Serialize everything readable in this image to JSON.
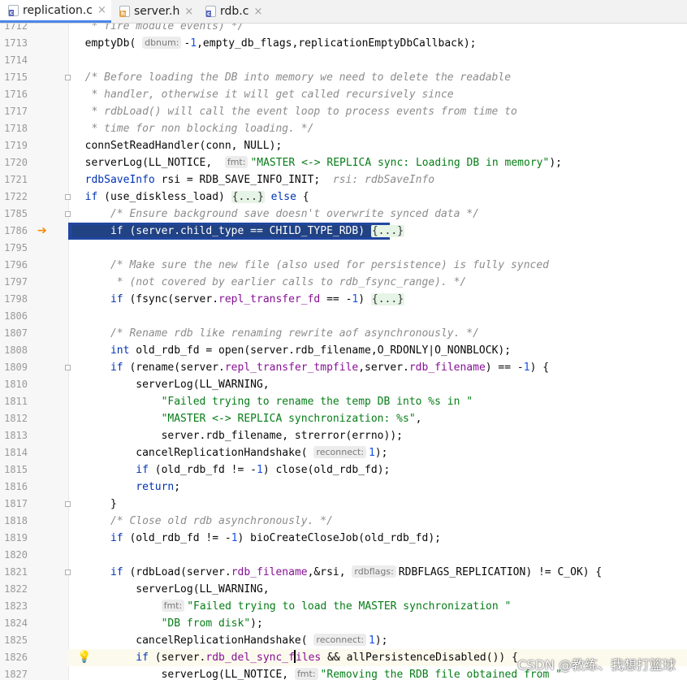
{
  "tabs": [
    {
      "label": "replication.c",
      "type": "c",
      "active": true
    },
    {
      "label": "server.h",
      "type": "h",
      "active": false
    },
    {
      "label": "rdb.c",
      "type": "c",
      "active": false
    }
  ],
  "tab_close_glyph": "×",
  "lines": [
    {
      "num": "1712",
      "segs": [
        [
          "cm",
          "   * fire module events) */"
        ]
      ]
    },
    {
      "num": "1713",
      "segs": [
        [
          "",
          "  emptyDb( "
        ],
        [
          "hint",
          "dbnum:"
        ],
        [
          "",
          "-"
        ],
        [
          "num",
          "1"
        ],
        [
          "",
          ",empty_db_flags,replicationEmptyDbCallback);"
        ]
      ]
    },
    {
      "num": "1714",
      "segs": []
    },
    {
      "num": "1715",
      "segs": [
        [
          "cm",
          "  /* Before loading the DB into memory we need to delete the readable"
        ]
      ]
    },
    {
      "num": "1716",
      "segs": [
        [
          "cm",
          "   * handler, otherwise it will get called recursively since"
        ]
      ]
    },
    {
      "num": "1717",
      "segs": [
        [
          "cm",
          "   * rdbLoad() will call the event loop to process events from time to"
        ]
      ]
    },
    {
      "num": "1718",
      "segs": [
        [
          "cm",
          "   * time for non blocking loading. */"
        ]
      ]
    },
    {
      "num": "1719",
      "segs": [
        [
          "",
          "  connSetReadHandler(conn, NULL);"
        ]
      ]
    },
    {
      "num": "1720",
      "segs": [
        [
          "",
          "  serverLog(LL_NOTICE,  "
        ],
        [
          "hint",
          "fmt:"
        ],
        [
          "str",
          "\"MASTER <-> REPLICA sync: Loading DB in memory\""
        ],
        [
          "",
          ");"
        ]
      ]
    },
    {
      "num": "1721",
      "segs": [
        [
          "kw",
          "  rdbSaveInfo"
        ],
        [
          "",
          " rsi = RDB_SAVE_INFO_INIT;  "
        ],
        [
          "cm",
          "rsi: rdbSaveInfo"
        ]
      ]
    },
    {
      "num": "1722",
      "segs": [
        [
          "kw",
          "  if"
        ],
        [
          "",
          " (use_diskless_load) "
        ],
        [
          "fold",
          "{...}"
        ],
        [
          "kw",
          " else"
        ],
        [
          "",
          " {"
        ]
      ]
    },
    {
      "num": "1785",
      "segs": [
        [
          "cm",
          "      /* Ensure background save doesn't overwrite synced data */"
        ]
      ]
    },
    {
      "num": "1786",
      "selected": true,
      "segs": [
        [
          "sel",
          "      if (server.child_type == CHILD_TYPE_RDB) "
        ],
        [
          "fold",
          "{...}"
        ]
      ]
    },
    {
      "num": "1795",
      "segs": []
    },
    {
      "num": "1796",
      "segs": [
        [
          "cm",
          "      /* Make sure the new file (also used for persistence) is fully synced"
        ]
      ]
    },
    {
      "num": "1797",
      "segs": [
        [
          "cm",
          "       * (not covered by earlier calls to rdb_fsync_range). */"
        ]
      ]
    },
    {
      "num": "1798",
      "segs": [
        [
          "kw",
          "      if"
        ],
        [
          "",
          " (fsync(server."
        ],
        [
          "fld",
          "repl_transfer_fd"
        ],
        [
          "",
          " == -"
        ],
        [
          "num",
          "1"
        ],
        [
          "",
          ") "
        ],
        [
          "fold",
          "{...}"
        ]
      ]
    },
    {
      "num": "1806",
      "segs": []
    },
    {
      "num": "1807",
      "segs": [
        [
          "cm",
          "      /* Rename rdb like renaming rewrite aof asynchronously. */"
        ]
      ]
    },
    {
      "num": "1808",
      "segs": [
        [
          "kw",
          "      int"
        ],
        [
          "",
          " old_rdb_fd = open(server.rdb_filename,O_RDONLY|O_NONBLOCK);"
        ]
      ]
    },
    {
      "num": "1809",
      "segs": [
        [
          "kw",
          "      if"
        ],
        [
          "",
          " (rename(server."
        ],
        [
          "fld",
          "repl_transfer_tmpfile"
        ],
        [
          "",
          ",server."
        ],
        [
          "fld",
          "rdb_filename"
        ],
        [
          "",
          ") == -"
        ],
        [
          "num",
          "1"
        ],
        [
          "",
          ") {"
        ]
      ]
    },
    {
      "num": "1810",
      "segs": [
        [
          "",
          "          serverLog(LL_WARNING,"
        ]
      ]
    },
    {
      "num": "1811",
      "segs": [
        [
          "str",
          "              \"Failed trying to rename the temp DB into %s in \""
        ]
      ]
    },
    {
      "num": "1812",
      "segs": [
        [
          "str",
          "              \"MASTER <-> REPLICA synchronization: %s\""
        ],
        [
          "",
          ","
        ]
      ]
    },
    {
      "num": "1813",
      "segs": [
        [
          "",
          "              server.rdb_filename, strerror(errno));"
        ]
      ]
    },
    {
      "num": "1814",
      "segs": [
        [
          "",
          "          cancelReplicationHandshake( "
        ],
        [
          "hint",
          "reconnect:"
        ],
        [
          "num",
          "1"
        ],
        [
          "",
          ");"
        ]
      ]
    },
    {
      "num": "1815",
      "segs": [
        [
          "kw",
          "          if"
        ],
        [
          "",
          " (old_rdb_fd != -"
        ],
        [
          "num",
          "1"
        ],
        [
          "",
          ") close(old_rdb_fd);"
        ]
      ]
    },
    {
      "num": "1816",
      "segs": [
        [
          "kw",
          "          return"
        ],
        [
          "",
          ";"
        ]
      ]
    },
    {
      "num": "1817",
      "segs": [
        [
          "",
          "      }"
        ]
      ]
    },
    {
      "num": "1818",
      "segs": [
        [
          "cm",
          "      /* Close old rdb asynchronously. */"
        ]
      ]
    },
    {
      "num": "1819",
      "segs": [
        [
          "kw",
          "      if"
        ],
        [
          "",
          " (old_rdb_fd != -"
        ],
        [
          "num",
          "1"
        ],
        [
          "",
          ") bioCreateCloseJob(old_rdb_fd);"
        ]
      ]
    },
    {
      "num": "1820",
      "segs": []
    },
    {
      "num": "1821",
      "segs": [
        [
          "kw",
          "      if"
        ],
        [
          "",
          " (rdbLoad(server."
        ],
        [
          "fld",
          "rdb_filename"
        ],
        [
          "",
          ",&rsi, "
        ],
        [
          "hint",
          "rdbflags:"
        ],
        [
          "",
          "RDBFLAGS_REPLICATION) != C_OK) {"
        ]
      ]
    },
    {
      "num": "1822",
      "segs": [
        [
          "",
          "          serverLog(LL_WARNING,"
        ]
      ]
    },
    {
      "num": "1823",
      "segs": [
        [
          "",
          "              "
        ],
        [
          "hint",
          "fmt:"
        ],
        [
          "str",
          "\"Failed trying to load the MASTER synchronization \""
        ]
      ]
    },
    {
      "num": "1824",
      "segs": [
        [
          "str",
          "              \"DB from disk\""
        ],
        [
          "",
          ");"
        ]
      ]
    },
    {
      "num": "1825",
      "segs": [
        [
          "",
          "          cancelReplicationHandshake( "
        ],
        [
          "hint",
          "reconnect:"
        ],
        [
          "num",
          "1"
        ],
        [
          "",
          ");"
        ]
      ]
    },
    {
      "num": "1826",
      "current": true,
      "segs": [
        [
          "kw",
          "          if"
        ],
        [
          "",
          " (server."
        ],
        [
          "fld",
          "rdb_del_sync_f"
        ],
        [
          "caret",
          ""
        ],
        [
          "fld",
          "iles"
        ],
        [
          "",
          " && allPersistenceDisabled()) {"
        ]
      ]
    },
    {
      "num": "1827",
      "segs": [
        [
          "",
          "              serverLog(LL_NOTICE, "
        ],
        [
          "hint",
          "fmt:"
        ],
        [
          "str",
          "\"Removing the RDB file obtained from \""
        ]
      ]
    }
  ],
  "gutter": {
    "execution_arrow": "➔",
    "intention_bulb": "💡",
    "arrow_line": "1786",
    "bulb_line": "1826"
  },
  "watermark": "CSDN @教练、我想打篮球"
}
